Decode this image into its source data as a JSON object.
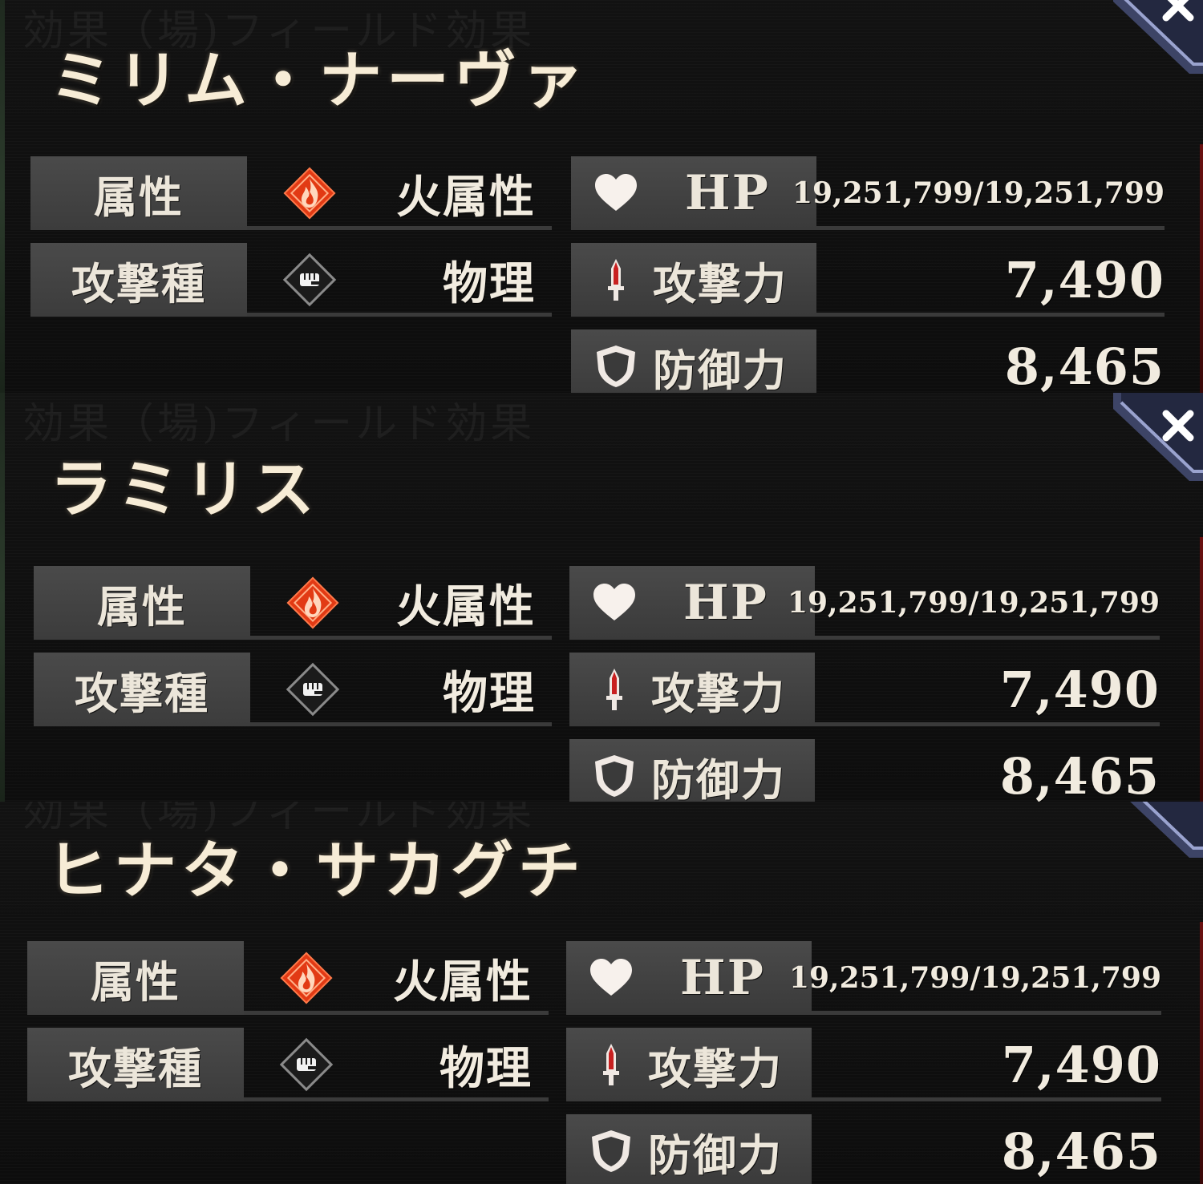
{
  "ghost_text": "効果（場)フィールド効果",
  "labels": {
    "attribute": "属性",
    "attack_type": "攻撃種",
    "hp": "HP",
    "attack": "攻撃力",
    "defense": "防御力"
  },
  "icons": {
    "fire": "fire-icon",
    "fist": "fist-icon",
    "heart": "heart-icon",
    "sword": "sword-icon",
    "shield": "shield-icon",
    "close": "close-icon"
  },
  "colors": {
    "fire": "#e23a14",
    "name": "#f7ecd6",
    "label_bg": "#454545"
  },
  "characters": [
    {
      "name": "ミリム・ナーヴァ",
      "attribute": "火属性",
      "attack_type": "物理",
      "hp": "19,251,799/19,251,799",
      "attack": "7,490",
      "defense": "8,465"
    },
    {
      "name": "ラミリス",
      "attribute": "火属性",
      "attack_type": "物理",
      "hp": "19,251,799/19,251,799",
      "attack": "7,490",
      "defense": "8,465"
    },
    {
      "name": "ヒナタ・サカグチ",
      "attribute": "火属性",
      "attack_type": "物理",
      "hp": "19,251,799/19,251,799",
      "attack": "7,490",
      "defense": "8,465"
    }
  ]
}
